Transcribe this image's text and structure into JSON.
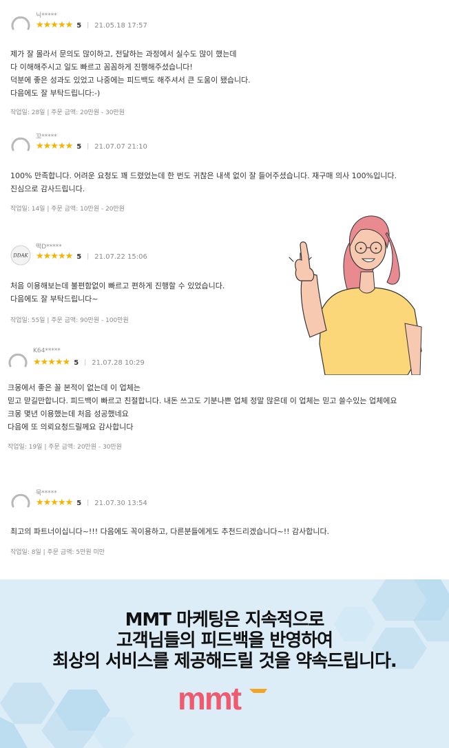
{
  "reviews": [
    {
      "user": "닉*****",
      "stars": "★★★★★",
      "score": "5",
      "date": "21.05.18 17:57",
      "lines": [
        "제가 잘 몰라서 문의도 많이하고, 전달하는 과정에서 실수도 많이 했는데",
        "다 이해해주시고 일도 빠르고 꼼꼼하게 진행해주셨습니다!",
        "덕분에 좋은 성과도 있었고 나중에는 피드백도 해주셔서 큰 도움이 됐습니다.",
        "다음에도 잘 부탁드립니다:-)"
      ],
      "footer": "작업일: 28일 | 주문 금액: 20만원 - 30만원"
    },
    {
      "user": "꼬*****",
      "stars": "★★★★★",
      "score": "5",
      "date": "21.07.07 21:10",
      "lines": [
        "100% 만족합니다. 어려운 요청도 꽤 드렸었는데 한 번도 귀찮은 내색 없이 잘 들어주셨습니다. 재구매 의사 100%입니다.",
        "진심으로 감사드립니다."
      ],
      "footer": "작업일: 14일 | 주문 금액: 10만원 - 20만원"
    },
    {
      "user": "떡D*****",
      "avatar_text": "DDAK",
      "stars": "★★★★★",
      "score": "5",
      "date": "21.07.22 15:06",
      "lines": [
        "처음 이용해보는데 불편함없이 빠르고 편하게 진행할 수 있었습니다.",
        "다음에도 잘 부탁드립니다~"
      ],
      "footer": "작업일: 55일 | 주문 금액: 90만원 - 100만원"
    },
    {
      "user": "K64*****",
      "stars": "★★★★★",
      "score": "5",
      "date": "21.07.28 10:29",
      "lines": [
        "크몽에서 좋은 꼴 본적이 없는데 이 업체는",
        "믿고 맏길만합니다. 피드백이 빠르고 친절합니다. 내돈 쓰고도 기분나쁜 업체 정말 많은데 이 업체는 믿고 쓸수있는 업체에요",
        "크몽 몇년 이용했는데 처음 성공했네요",
        "다음에 또 의뢰요청드릴께요 감사합니다"
      ],
      "footer": "작업일: 19일 | 주문 금액: 20만원 - 30만원"
    },
    {
      "user": "묵*****",
      "stars": "★★★★★",
      "score": "5",
      "date": "21.07.30 13:54",
      "lines": [
        "최고의 파트너이십니다~!!! 다음에도 꼭이용하고, 다른분들에게도 추천드리겠습니다~!! 감사합니다."
      ],
      "footer": "작업일: 8일 | 주문 금액: 5만원 미만"
    }
  ],
  "banner": {
    "lines": [
      "MMT 마케팅은 지속적으로",
      "고객님들의 피드백을 반영하여",
      "최상의 서비스를 제공해드릴 것을 약속드립니다."
    ],
    "logo_text": "mmt",
    "colors": {
      "logo": "#ef5a6f",
      "arrow": "#f5a524",
      "background": "#dcedf8"
    }
  },
  "colors": {
    "star": "#f5b400"
  }
}
